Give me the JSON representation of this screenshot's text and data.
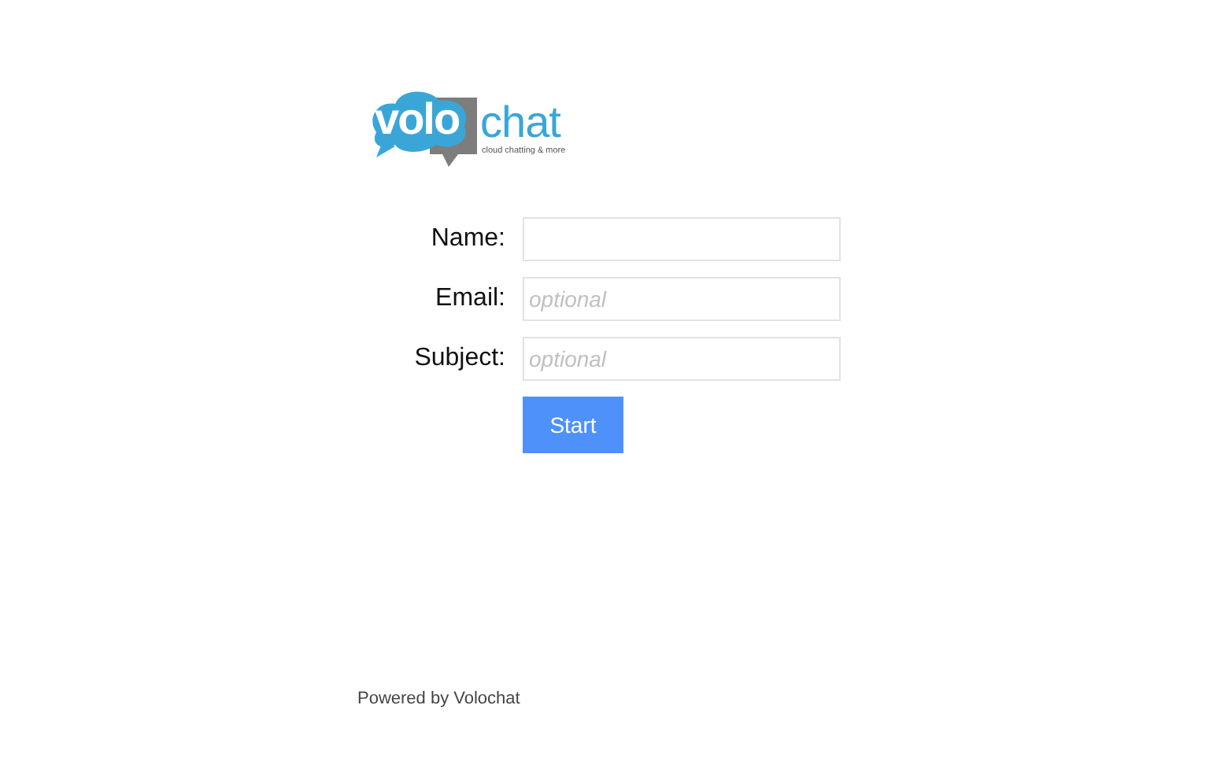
{
  "logo": {
    "word_1": "volo",
    "word_2": "chat",
    "tagline": "cloud chatting & more"
  },
  "form": {
    "fields": [
      {
        "label": "Name:"
      },
      {
        "label": "Email:",
        "placeholder": "optional"
      },
      {
        "label": "Subject:",
        "placeholder": "optional"
      }
    ],
    "submit": "Start"
  },
  "footer": "Powered by Volochat"
}
